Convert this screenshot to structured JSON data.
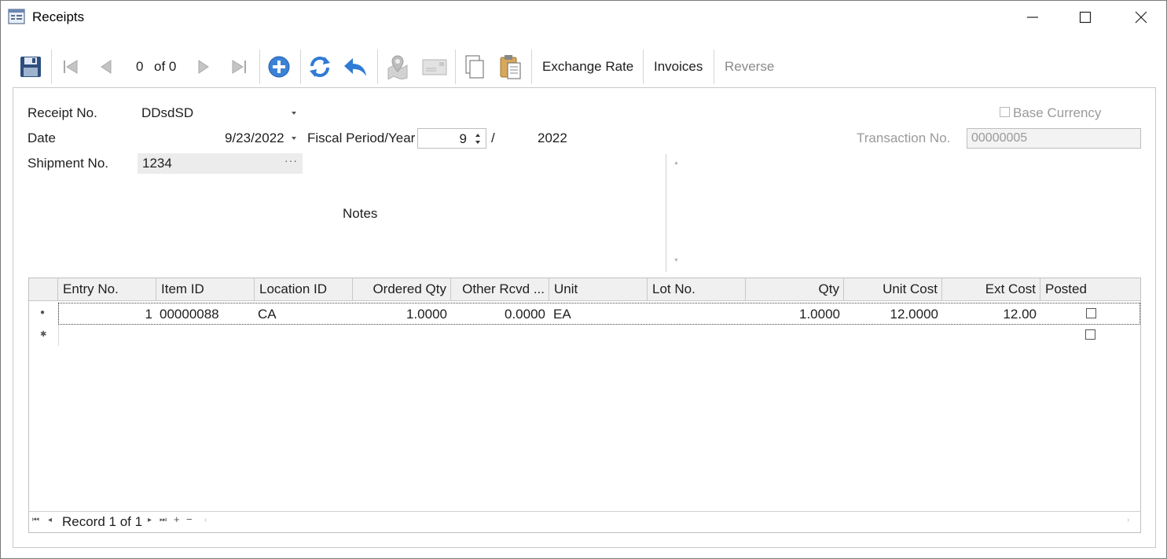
{
  "window": {
    "title": "Receipts",
    "app_icon": "form-icon"
  },
  "toolbar": {
    "record_position": "0",
    "record_total": "of 0",
    "exchange_rate": "Exchange Rate",
    "invoices": "Invoices",
    "reverse": "Reverse",
    "icons": [
      "save-icon",
      "first-record-icon",
      "previous-record-icon",
      "next-record-icon",
      "last-record-icon",
      "add-icon",
      "refresh-icon",
      "undo-icon",
      "map-icon",
      "mail-icon",
      "copy-icon",
      "paste-icon"
    ]
  },
  "form": {
    "receipt_no_label": "Receipt No.",
    "receipt_no_value": "DDsdSD",
    "date_label": "Date",
    "date_value": "9/23/2022",
    "fiscal_label": "Fiscal Period/Year",
    "fiscal_period": "9",
    "fiscal_sep": "/",
    "fiscal_year": "2022",
    "base_currency_label": "Base Currency",
    "transaction_label": "Transaction No.",
    "transaction_value": "00000005",
    "shipment_label": "Shipment No.",
    "shipment_value": "1234",
    "notes_label": "Notes"
  },
  "grid": {
    "columns": [
      "Entry No.",
      "Item ID",
      "Location ID",
      "Ordered Qty",
      "Other Rcvd ...",
      "Unit",
      "Lot No.",
      "Qty",
      "Unit Cost",
      "Ext Cost",
      "Posted"
    ],
    "rows": [
      {
        "entry_no": "1",
        "item_id": "00000088",
        "location_id": "CA",
        "ordered_qty": "1.0000",
        "other_rcvd": "0.0000",
        "unit": "EA",
        "lot_no": "",
        "qty": "1.0000",
        "unit_cost": "12.0000",
        "ext_cost": "12.00",
        "posted": false
      }
    ],
    "navigator": {
      "record_text": "Record 1 of 1"
    }
  },
  "colors": {
    "accent_blue": "#2f7bd6",
    "disabled_gray": "#9a9a9a"
  }
}
